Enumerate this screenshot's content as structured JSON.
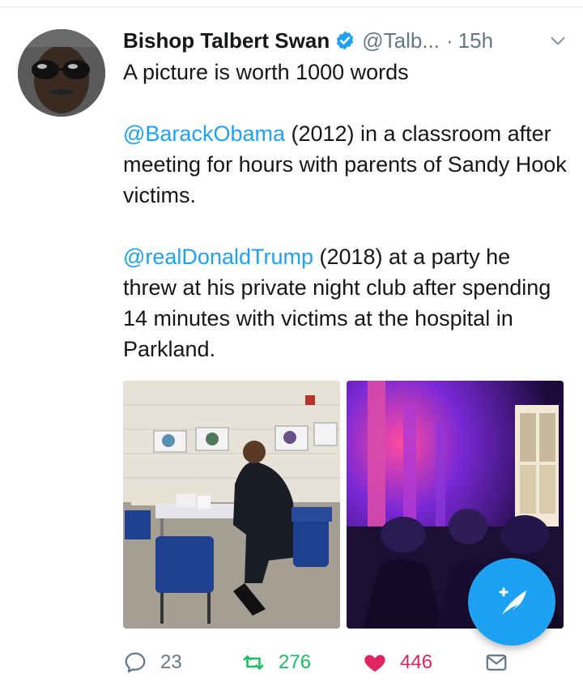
{
  "tweet": {
    "author": {
      "display_name": "Bishop Talbert Swan",
      "handle": "@Talb...",
      "verified": true
    },
    "timestamp_separator": "·",
    "timestamp": "15h",
    "text": {
      "line1": "A picture is worth 1000 words",
      "para2_mention": "@BarackObama",
      "para2_rest": " (2012) in a classroom after meeting for hours with parents of Sandy Hook victims.",
      "para3_mention": "@realDonaldTrump",
      "para3_rest": " (2018) at a party he threw at his private night club after spending 14 minutes with victims at the hospital in Parkland."
    },
    "actions": {
      "replies": "23",
      "retweets": "276",
      "likes": "446"
    }
  },
  "colors": {
    "accent": "#1da1f2",
    "retweet": "#17bf63",
    "like": "#e0245e",
    "muted": "#657786"
  },
  "icons": {
    "verified": "verified-badge-icon",
    "menu": "chevron-down-icon",
    "reply": "reply-icon",
    "retweet": "retweet-icon",
    "like": "heart-icon",
    "dm": "envelope-icon",
    "compose": "compose-tweet-icon"
  }
}
